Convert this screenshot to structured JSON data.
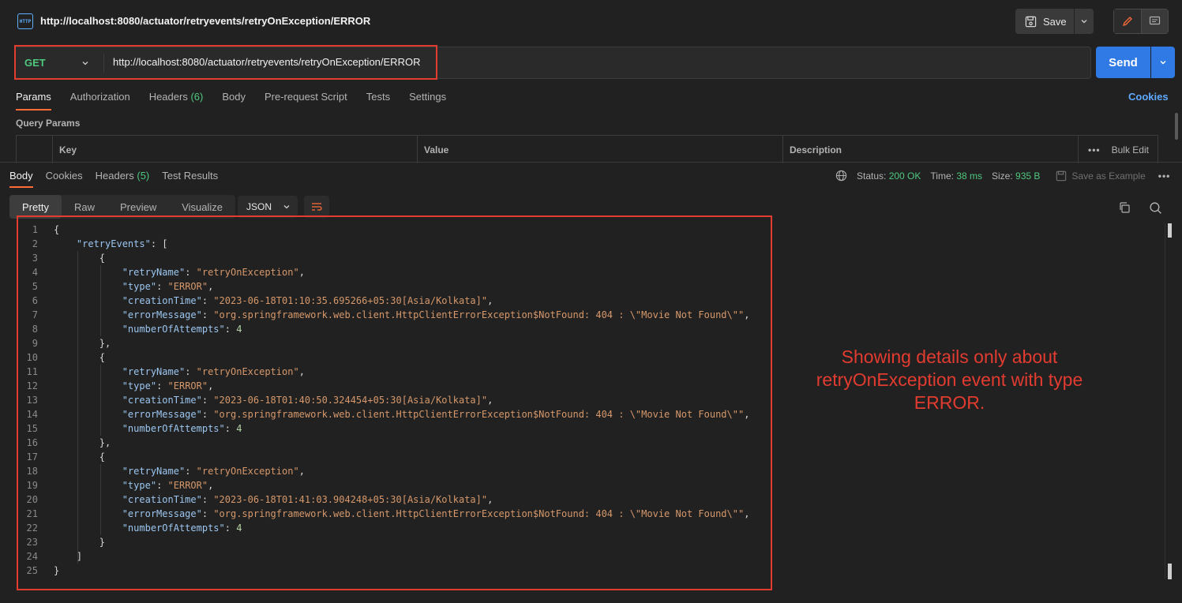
{
  "tab": {
    "title": "http://localhost:8080/actuator/retryevents/retryOnException/ERROR",
    "icon": "http-icon",
    "save_label": "Save"
  },
  "request": {
    "method": "GET",
    "url": "http://localhost:8080/actuator/retryevents/retryOnException/ERROR",
    "send_label": "Send"
  },
  "req_tabs": {
    "params": "Params",
    "authorization": "Authorization",
    "headers": "Headers",
    "headers_count": "(6)",
    "body": "Body",
    "prerequest": "Pre-request Script",
    "tests": "Tests",
    "settings": "Settings",
    "cookies": "Cookies"
  },
  "query_params": {
    "title": "Query Params",
    "key": "Key",
    "value": "Value",
    "description": "Description",
    "bulk_edit": "Bulk Edit"
  },
  "response": {
    "tabs": {
      "body": "Body",
      "cookies": "Cookies",
      "headers": "Headers",
      "headers_count": "(5)",
      "test_results": "Test Results"
    },
    "status_label": "Status:",
    "status_value": "200 OK",
    "time_label": "Time:",
    "time_value": "38 ms",
    "size_label": "Size:",
    "size_value": "935 B",
    "save_example": "Save as Example",
    "views": {
      "pretty": "Pretty",
      "raw": "Raw",
      "preview": "Preview",
      "visualize": "Visualize"
    },
    "format": "JSON"
  },
  "annotation": "Showing details only about retryOnException event with type ERROR.",
  "code_lines": [
    {
      "n": "1",
      "parts": [
        [
          "t",
          "{"
        ]
      ]
    },
    {
      "n": "2",
      "parts": [
        [
          "t",
          "    "
        ],
        [
          "k",
          "\"retryEvents\""
        ],
        [
          "t",
          ": ["
        ]
      ]
    },
    {
      "n": "3",
      "parts": [
        [
          "t",
          "        {"
        ]
      ]
    },
    {
      "n": "4",
      "parts": [
        [
          "t",
          "            "
        ],
        [
          "k",
          "\"retryName\""
        ],
        [
          "t",
          ": "
        ],
        [
          "s",
          "\"retryOnException\""
        ],
        [
          "t",
          ","
        ]
      ]
    },
    {
      "n": "5",
      "parts": [
        [
          "t",
          "            "
        ],
        [
          "k",
          "\"type\""
        ],
        [
          "t",
          ": "
        ],
        [
          "s",
          "\"ERROR\""
        ],
        [
          "t",
          ","
        ]
      ]
    },
    {
      "n": "6",
      "parts": [
        [
          "t",
          "            "
        ],
        [
          "k",
          "\"creationTime\""
        ],
        [
          "t",
          ": "
        ],
        [
          "s",
          "\"2023-06-18T01:10:35.695266+05:30[Asia/Kolkata]\""
        ],
        [
          "t",
          ","
        ]
      ]
    },
    {
      "n": "7",
      "parts": [
        [
          "t",
          "            "
        ],
        [
          "k",
          "\"errorMessage\""
        ],
        [
          "t",
          ": "
        ],
        [
          "s",
          "\"org.springframework.web.client.HttpClientErrorException$NotFound: 404 : \\\"Movie Not Found\\\"\""
        ],
        [
          "t",
          ","
        ]
      ]
    },
    {
      "n": "8",
      "parts": [
        [
          "t",
          "            "
        ],
        [
          "k",
          "\"numberOfAttempts\""
        ],
        [
          "t",
          ": "
        ],
        [
          "n",
          "4"
        ]
      ]
    },
    {
      "n": "9",
      "parts": [
        [
          "t",
          "        },"
        ]
      ]
    },
    {
      "n": "10",
      "parts": [
        [
          "t",
          "        {"
        ]
      ]
    },
    {
      "n": "11",
      "parts": [
        [
          "t",
          "            "
        ],
        [
          "k",
          "\"retryName\""
        ],
        [
          "t",
          ": "
        ],
        [
          "s",
          "\"retryOnException\""
        ],
        [
          "t",
          ","
        ]
      ]
    },
    {
      "n": "12",
      "parts": [
        [
          "t",
          "            "
        ],
        [
          "k",
          "\"type\""
        ],
        [
          "t",
          ": "
        ],
        [
          "s",
          "\"ERROR\""
        ],
        [
          "t",
          ","
        ]
      ]
    },
    {
      "n": "13",
      "parts": [
        [
          "t",
          "            "
        ],
        [
          "k",
          "\"creationTime\""
        ],
        [
          "t",
          ": "
        ],
        [
          "s",
          "\"2023-06-18T01:40:50.324454+05:30[Asia/Kolkata]\""
        ],
        [
          "t",
          ","
        ]
      ]
    },
    {
      "n": "14",
      "parts": [
        [
          "t",
          "            "
        ],
        [
          "k",
          "\"errorMessage\""
        ],
        [
          "t",
          ": "
        ],
        [
          "s",
          "\"org.springframework.web.client.HttpClientErrorException$NotFound: 404 : \\\"Movie Not Found\\\"\""
        ],
        [
          "t",
          ","
        ]
      ]
    },
    {
      "n": "15",
      "parts": [
        [
          "t",
          "            "
        ],
        [
          "k",
          "\"numberOfAttempts\""
        ],
        [
          "t",
          ": "
        ],
        [
          "n",
          "4"
        ]
      ]
    },
    {
      "n": "16",
      "parts": [
        [
          "t",
          "        },"
        ]
      ]
    },
    {
      "n": "17",
      "parts": [
        [
          "t",
          "        {"
        ]
      ]
    },
    {
      "n": "18",
      "parts": [
        [
          "t",
          "            "
        ],
        [
          "k",
          "\"retryName\""
        ],
        [
          "t",
          ": "
        ],
        [
          "s",
          "\"retryOnException\""
        ],
        [
          "t",
          ","
        ]
      ]
    },
    {
      "n": "19",
      "parts": [
        [
          "t",
          "            "
        ],
        [
          "k",
          "\"type\""
        ],
        [
          "t",
          ": "
        ],
        [
          "s",
          "\"ERROR\""
        ],
        [
          "t",
          ","
        ]
      ]
    },
    {
      "n": "20",
      "parts": [
        [
          "t",
          "            "
        ],
        [
          "k",
          "\"creationTime\""
        ],
        [
          "t",
          ": "
        ],
        [
          "s",
          "\"2023-06-18T01:41:03.904248+05:30[Asia/Kolkata]\""
        ],
        [
          "t",
          ","
        ]
      ]
    },
    {
      "n": "21",
      "parts": [
        [
          "t",
          "            "
        ],
        [
          "k",
          "\"errorMessage\""
        ],
        [
          "t",
          ": "
        ],
        [
          "s",
          "\"org.springframework.web.client.HttpClientErrorException$NotFound: 404 : \\\"Movie Not Found\\\"\""
        ],
        [
          "t",
          ","
        ]
      ]
    },
    {
      "n": "22",
      "parts": [
        [
          "t",
          "            "
        ],
        [
          "k",
          "\"numberOfAttempts\""
        ],
        [
          "t",
          ": "
        ],
        [
          "n",
          "4"
        ]
      ]
    },
    {
      "n": "23",
      "parts": [
        [
          "t",
          "        }"
        ]
      ]
    },
    {
      "n": "24",
      "parts": [
        [
          "t",
          "    ]"
        ]
      ]
    },
    {
      "n": "25",
      "parts": [
        [
          "t",
          "}"
        ]
      ]
    }
  ]
}
